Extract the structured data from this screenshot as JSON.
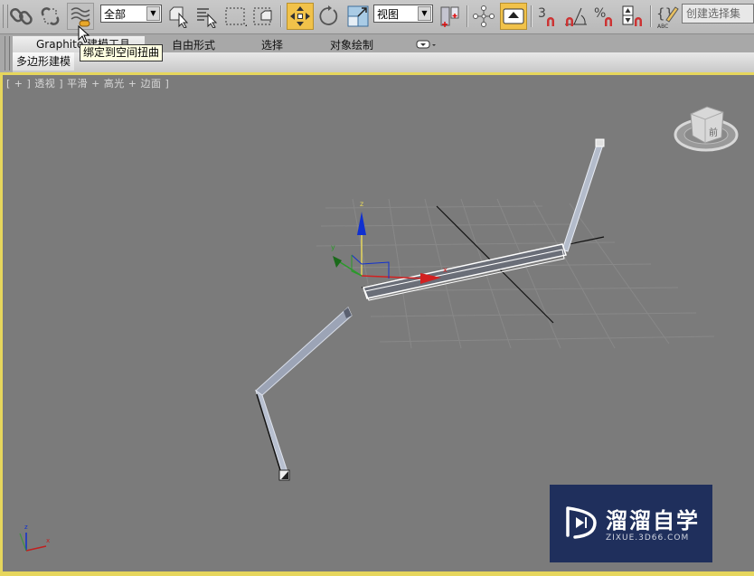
{
  "toolbar": {
    "buttons": [
      {
        "name": "select-and-link",
        "icon": "link-icon"
      },
      {
        "name": "unlink-selection",
        "icon": "unlink-icon"
      },
      {
        "name": "bind-to-space-warp",
        "icon": "space-warp-icon"
      },
      {
        "name": "select-object",
        "icon": "select-object-icon"
      },
      {
        "name": "select-by-name",
        "icon": "select-by-name-icon"
      },
      {
        "name": "rectangular-selection-region",
        "icon": "rect-selection-icon"
      },
      {
        "name": "window-crossing",
        "icon": "window-crossing-icon"
      },
      {
        "name": "select-and-move",
        "icon": "move-icon",
        "active": true
      },
      {
        "name": "select-and-rotate",
        "icon": "rotate-icon"
      },
      {
        "name": "select-and-scale",
        "icon": "scale-icon"
      },
      {
        "name": "use-pivot-point-center",
        "icon": "pivot-icon"
      },
      {
        "name": "select-and-manipulate",
        "icon": "manipulate-icon"
      },
      {
        "name": "keyboard-shortcut-override",
        "icon": "keyboard-override-icon",
        "active": true
      },
      {
        "name": "snaps-toggle",
        "icon": "snap-3d-icon",
        "label": "3"
      },
      {
        "name": "angle-snap-toggle",
        "icon": "angle-snap-icon"
      },
      {
        "name": "percent-snap-toggle",
        "icon": "percent-snap-icon",
        "label": "%"
      },
      {
        "name": "spinner-snap-toggle",
        "icon": "spinner-snap-icon"
      },
      {
        "name": "edit-named-selection-sets",
        "icon": "named-selection-icon",
        "label": "ABC"
      }
    ],
    "selection_filter": "全部",
    "reference_coordinate_system": "视图",
    "named_selection_set_placeholder": "创建选择集"
  },
  "ribbon": {
    "tabs": [
      {
        "label": "Graphite 建模工具",
        "active": true
      },
      {
        "label": "自由形式"
      },
      {
        "label": "选择"
      },
      {
        "label": "对象绘制"
      }
    ],
    "subtab": "多边形建模"
  },
  "tooltip": "绑定到空间扭曲",
  "viewport": {
    "label": "[ + ] 透视 ] 平滑 + 高光 + 边面 ]",
    "label_parts": [
      "[ + ]",
      "透视",
      "]",
      "平滑",
      "+",
      "高光",
      "+",
      "边面",
      "]"
    ],
    "gizmo_axes": {
      "x": "x",
      "y": "y",
      "z": "z"
    },
    "corner_axes": {
      "x": "x",
      "z": "z"
    },
    "viewcube_face": "前"
  },
  "colors": {
    "viewport_border": "#e6d65c",
    "active_button": "#f1c24a",
    "x_axis": "#d22020",
    "y_axis": "#2a9a2a",
    "z_axis": "#1030d0",
    "watermark_bg": "#1f2f5c"
  },
  "watermark": {
    "title": "溜溜自学",
    "url": "ZIXUE.3D66.COM"
  }
}
